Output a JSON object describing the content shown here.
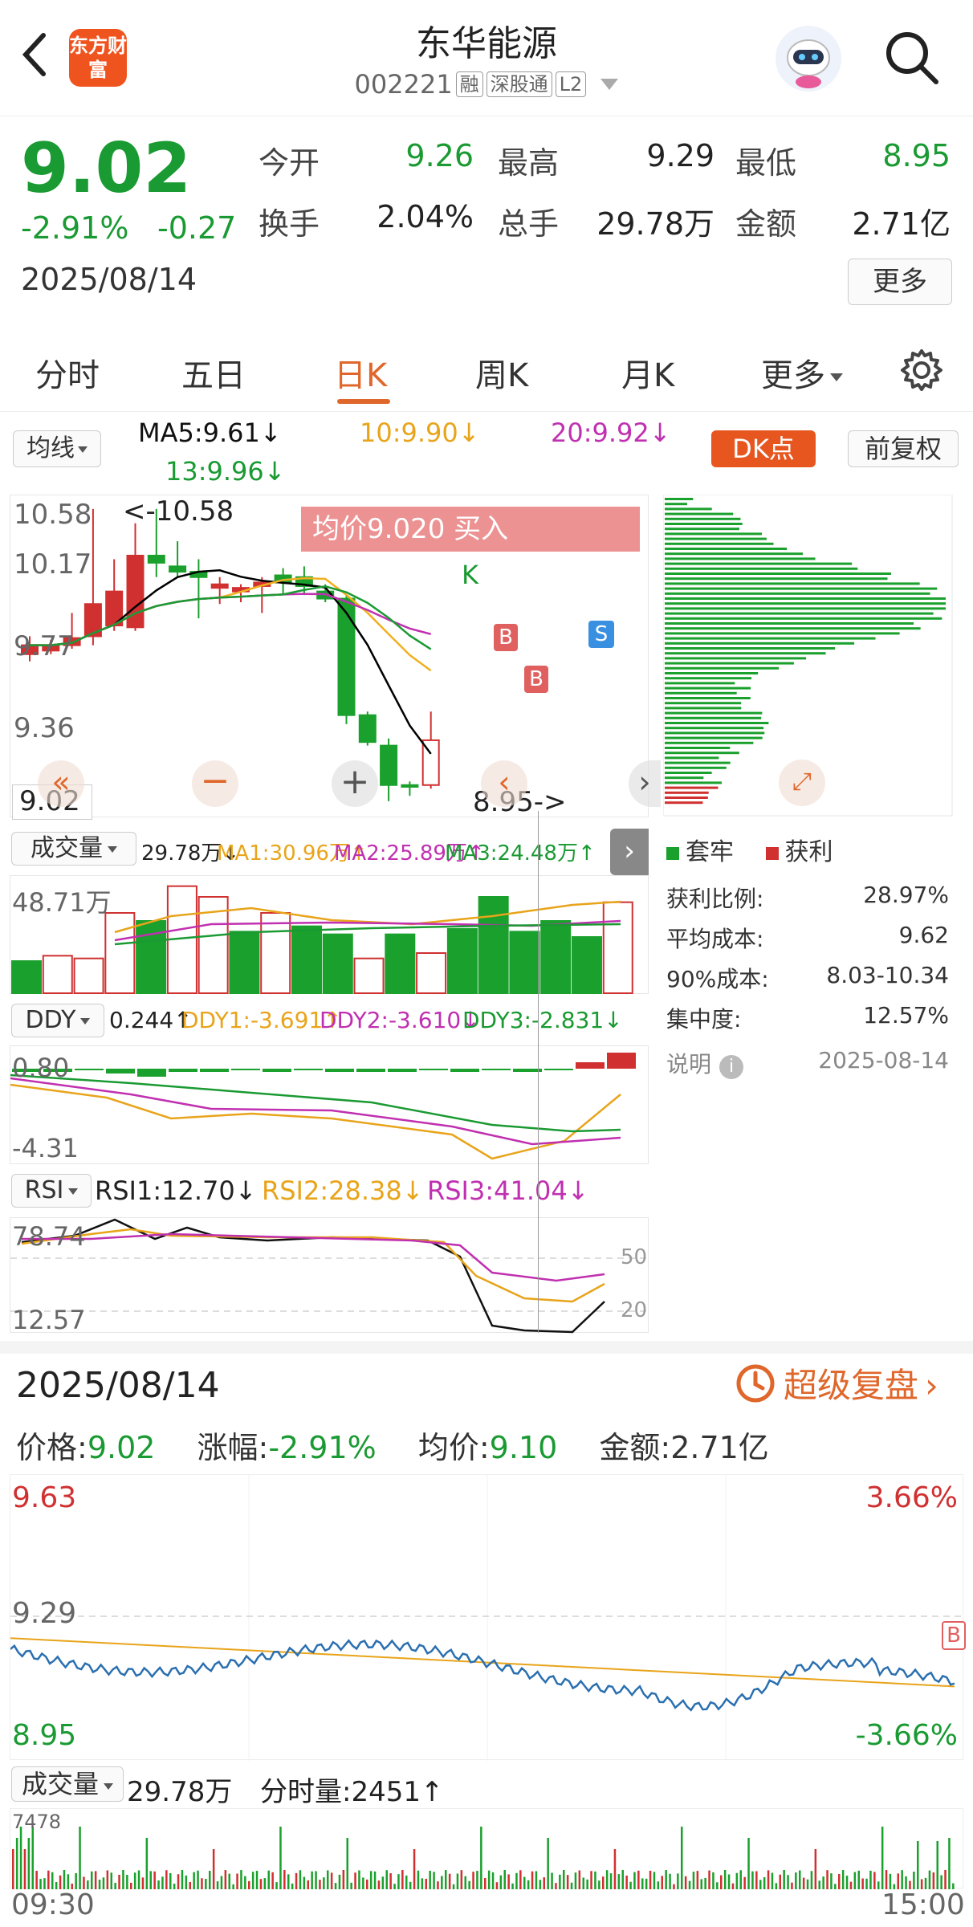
{
  "header": {
    "back_icon": "chevron-left-icon",
    "logo_text": "东方财富",
    "stock_name": "东华能源",
    "stock_code": "002221",
    "tags": [
      "融",
      "深股通",
      "L2"
    ],
    "avatar_icon": "robot-avatar-icon",
    "search_icon": "search-icon"
  },
  "quote": {
    "price": "9.02",
    "change_pct": "-2.91%",
    "change_amt": "-0.27",
    "date": "2025/08/14",
    "open_label": "今开",
    "open": "9.26",
    "high_label": "最高",
    "high": "9.29",
    "low_label": "最低",
    "low": "8.95",
    "turnover_label": "换手",
    "turnover": "2.04%",
    "volume_label": "总手",
    "volume": "29.78万",
    "amount_label": "金额",
    "amount": "2.71亿",
    "more_button": "更多"
  },
  "tabs": [
    "分时",
    "五日",
    "日K",
    "周K",
    "月K",
    "更多"
  ],
  "active_tab": "日K",
  "ma_bar": {
    "selector": "均线",
    "ma5": "MA5:9.61↓",
    "ma10": "10:9.90↓",
    "ma20": "20:9.92↓",
    "ma13": "13:9.96↓",
    "dk_button": "DK点",
    "adjust_button": "前复权"
  },
  "kline": {
    "y_labels": [
      "10.58",
      "10.17",
      "9.77",
      "9.36"
    ],
    "max_label": "<-10.58",
    "min_label": "8.95->",
    "current_price": "9.02",
    "avg_price_banner": "均价9.020  买入",
    "k_marker": "K",
    "b_marker": "B",
    "s_marker": "S",
    "colors": {
      "up": "#d03030",
      "down": "#1aa02c",
      "ma5": "#000000",
      "ma10": "#f0b020",
      "ma20": "#c030b0",
      "ma13": "#1a9a32"
    },
    "candles": [
      {
        "o": 9.77,
        "c": 9.82,
        "h": 9.87,
        "l": 9.73
      },
      {
        "o": 9.79,
        "c": 9.82,
        "h": 9.85,
        "l": 9.77
      },
      {
        "o": 9.82,
        "c": 9.86,
        "h": 10.0,
        "l": 9.8
      },
      {
        "o": 9.87,
        "c": 10.05,
        "h": 10.58,
        "l": 9.82
      },
      {
        "o": 9.93,
        "c": 10.12,
        "h": 10.3,
        "l": 9.9
      },
      {
        "o": 9.92,
        "c": 10.32,
        "h": 10.5,
        "l": 9.9
      },
      {
        "o": 10.32,
        "c": 10.28,
        "h": 10.58,
        "l": 10.2
      },
      {
        "o": 10.26,
        "c": 10.23,
        "h": 10.4,
        "l": 10.2
      },
      {
        "o": 10.23,
        "c": 10.2,
        "h": 10.3,
        "l": 9.97
      },
      {
        "o": 10.14,
        "c": 10.16,
        "h": 10.2,
        "l": 10.05
      },
      {
        "o": 10.12,
        "c": 10.14,
        "h": 10.16,
        "l": 10.06
      },
      {
        "o": 10.15,
        "c": 10.17,
        "h": 10.2,
        "l": 10.0
      },
      {
        "o": 10.21,
        "c": 10.17,
        "h": 10.25,
        "l": 10.1
      },
      {
        "o": 10.2,
        "c": 10.15,
        "h": 10.26,
        "l": 10.1
      },
      {
        "o": 10.12,
        "c": 10.08,
        "h": 10.16,
        "l": 10.06
      },
      {
        "o": 10.08,
        "c": 9.43,
        "h": 10.1,
        "l": 9.38
      },
      {
        "o": 9.43,
        "c": 9.28,
        "h": 9.45,
        "l": 9.26
      },
      {
        "o": 9.26,
        "c": 9.04,
        "h": 9.3,
        "l": 8.95
      },
      {
        "o": 9.04,
        "c": 9.03,
        "h": 9.06,
        "l": 8.98
      },
      {
        "o": 9.04,
        "c": 9.29,
        "h": 9.45,
        "l": 9.02
      }
    ]
  },
  "chip_panel": {
    "legend_trapped": "套牢",
    "legend_profit": "获利",
    "rows": [
      {
        "label": "获利比例:",
        "value": "28.97%"
      },
      {
        "label": "平均成本:",
        "value": "9.62"
      },
      {
        "label": "90%成本:",
        "value": "8.03-10.34"
      },
      {
        "label": "集中度:",
        "value": "12.57%"
      }
    ],
    "note_label": "说明",
    "note_date": "2025-08-14"
  },
  "volume": {
    "selector": "成交量",
    "value": "29.78万↓",
    "ma1": "MA1:30.96万↑",
    "ma2": "MA2:25.89万↑",
    "ma3": "MA3:24.48万↑",
    "y_label": "48.71万",
    "bars": [
      12,
      14,
      13,
      30,
      27,
      40,
      36,
      23,
      30,
      25,
      22,
      13,
      22,
      15,
      24,
      36,
      23,
      27,
      21,
      34
    ]
  },
  "ddy": {
    "selector": "DDY",
    "value": "0.244↑",
    "ddy1": "DDY1:-3.691↑",
    "ddy2": "DDY2:-3.610↓",
    "ddy3": "DDY3:-2.831↓",
    "y_top": "0.80",
    "y_bottom": "-4.31"
  },
  "rsi": {
    "selector": "RSI",
    "rsi1": "RSI1:12.70↓",
    "rsi2": "RSI2:28.38↓",
    "rsi3": "RSI3:41.04↓",
    "y_top": "78.74",
    "y_bottom": "12.57",
    "ref50": "50",
    "ref20": "20"
  },
  "intraday": {
    "date": "2025/08/14",
    "replay_button": "超级复盘",
    "price_label": "价格:",
    "price": "9.02",
    "change_label": "涨幅:",
    "change": "-2.91%",
    "avg_label": "均价:",
    "avg": "9.10",
    "amount_label": "金额:",
    "amount": "2.71亿",
    "y_high": "9.63",
    "y_mid": "9.29",
    "y_low": "8.95",
    "pct_high": "3.66%",
    "pct_low": "-3.66%",
    "b_marker": "B",
    "vol_selector": "成交量",
    "vol_total": "29.78万",
    "minute_vol": "分时量:2451↑",
    "vol_y_label": "7478",
    "time_start": "09:30",
    "time_end": "15:00"
  }
}
